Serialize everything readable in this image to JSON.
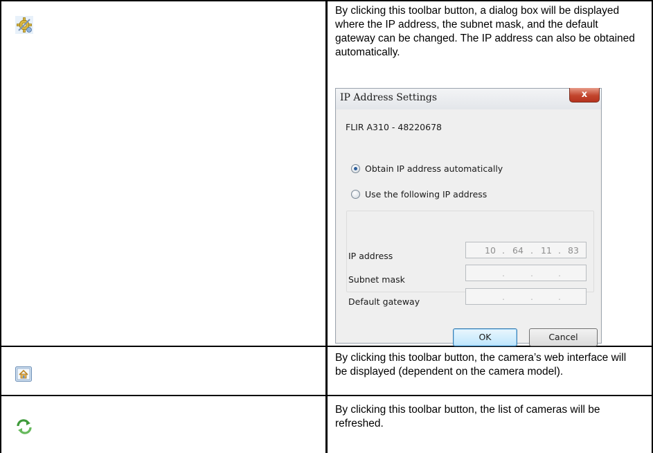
{
  "rows": [
    {
      "icon": "network-settings-icon",
      "description": "By clicking this toolbar button, a dialog box will be displayed where the IP address, the subnet mask, and the default gateway can be changed. The IP address can also be obtained automatically."
    },
    {
      "icon": "web-interface-icon",
      "description": "By clicking this toolbar button, the camera’s web interface will be displayed (dependent on the camera model)."
    },
    {
      "icon": "refresh-icon",
      "description": "By clicking this toolbar button, the list of cameras will be refreshed."
    }
  ],
  "dialog": {
    "title": "IP Address Settings",
    "close_glyph": "x",
    "device": "FLIR A310 - 48220678",
    "options": [
      {
        "label": "Obtain IP address automatically",
        "checked": true
      },
      {
        "label": "Use the following IP address",
        "checked": false
      }
    ],
    "fields": [
      {
        "label": "IP address",
        "octets": [
          "10",
          "64",
          "11",
          "83"
        ]
      },
      {
        "label": "Subnet mask",
        "octets": [
          "",
          "",
          "",
          ""
        ]
      },
      {
        "label": "Default gateway",
        "octets": [
          "",
          "",
          "",
          ""
        ]
      }
    ],
    "ok_label": "OK",
    "cancel_label": "Cancel"
  },
  "colors": {
    "border": "#000000",
    "dialog_bg": "#efefef",
    "close_button": "#c2452d",
    "ok_button_border": "#3c7fb1"
  }
}
